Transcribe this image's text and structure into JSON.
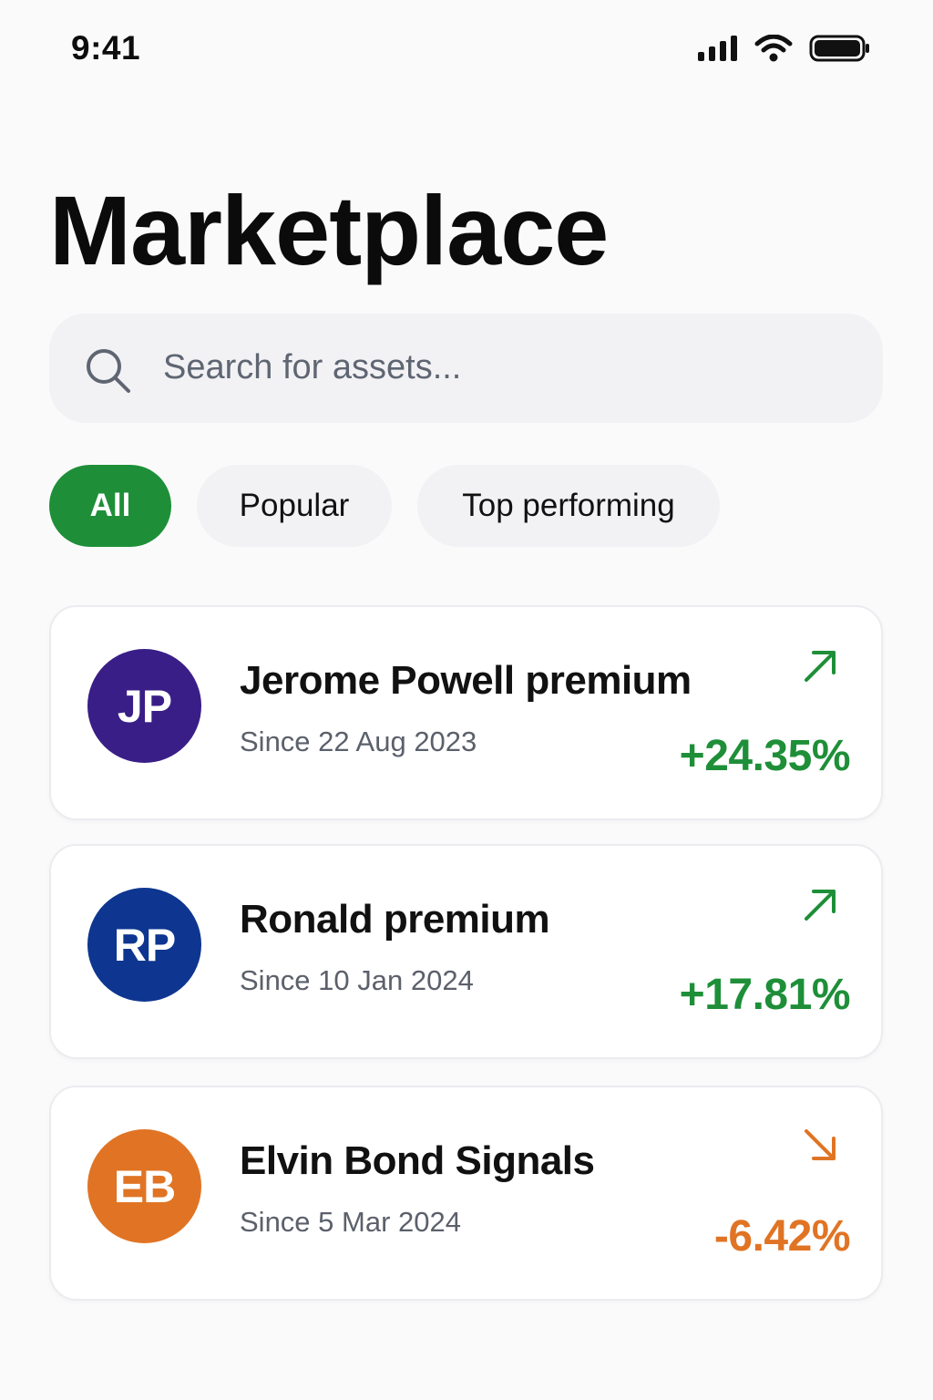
{
  "status_bar": {
    "time": "9:41"
  },
  "page": {
    "title": "Marketplace"
  },
  "search": {
    "placeholder": "Search for assets..."
  },
  "filters": [
    {
      "label": "All",
      "active": true
    },
    {
      "label": "Popular",
      "active": false
    },
    {
      "label": "Top performing",
      "active": false
    }
  ],
  "assets": [
    {
      "initials": "JP",
      "avatar_color": "#3a1e87",
      "name": "Jerome Powell premium",
      "since": "Since 22 Aug 2023",
      "change": "+24.35%",
      "trend": "up",
      "trend_icon": "arrow-up-right-icon",
      "change_color": "#1e8f38"
    },
    {
      "initials": "RP",
      "avatar_color": "#0e3690",
      "name": "Ronald premium",
      "since": "Since 10 Jan 2024",
      "change": "+17.81%",
      "trend": "up",
      "trend_icon": "arrow-up-right-icon",
      "change_color": "#1e8f38"
    },
    {
      "initials": "EB",
      "avatar_color": "#e07424",
      "name": "Elvin Bond Signals",
      "since": "Since 5 Mar 2024",
      "change": "-6.42%",
      "trend": "down",
      "trend_icon": "arrow-down-right-icon",
      "change_color": "#e07424"
    }
  ],
  "colors": {
    "accent": "#1e8f38",
    "negative": "#e07424",
    "background": "#fafafb"
  }
}
